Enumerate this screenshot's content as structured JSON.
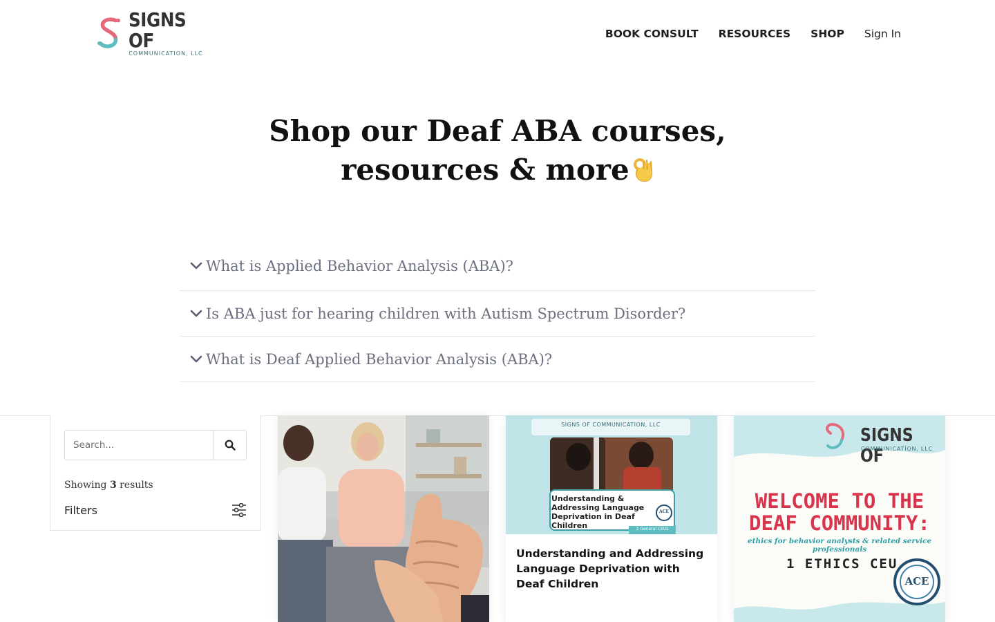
{
  "header": {
    "logo": {
      "title": "SIGNS OF",
      "subtitle": "COMMUNICATION, LLC"
    },
    "nav": [
      {
        "label": "BOOK CONSULT"
      },
      {
        "label": "RESOURCES"
      },
      {
        "label": "SHOP"
      },
      {
        "label": "Sign In"
      }
    ]
  },
  "hero": {
    "line1": "Shop our Deaf ABA courses,",
    "line2": "resources & more"
  },
  "faq": [
    {
      "question": "What is Applied Behavior Analysis (ABA)?"
    },
    {
      "question": "Is ABA just for hearing children with Autism Spectrum Disorder?"
    },
    {
      "question": "What is Deaf Applied Behavior Analysis (ABA)?"
    }
  ],
  "sidebar": {
    "search_placeholder": "Search...",
    "showing_prefix": "Showing",
    "showing_count": "3",
    "showing_suffix": "results",
    "filters_label": "Filters"
  },
  "products": [
    {
      "title": ""
    },
    {
      "title": "Understanding and Addressing Language Deprivation with Deaf Children",
      "image_header": "SIGNS OF COMMUNICATION, LLC",
      "image_caption": "Understanding & Addressing Language Deprivation in Deaf Children",
      "image_tag": "2 General CEUs",
      "image_seal": "ACE"
    },
    {
      "title": "",
      "image_logo_title": "SIGNS OF",
      "image_logo_sub": "COMMUNICATION, LLC",
      "image_heading_1": "WELCOME TO THE",
      "image_heading_2": "DEAF COMMUNITY:",
      "image_subheading": "ethics for behavior analysts & related service professionals",
      "image_ceu": "1 ETHICS CEU",
      "image_seal": "ACE"
    }
  ],
  "colors": {
    "brand_pink": "#e46a7b",
    "brand_teal": "#5fbcc0",
    "faq_text": "#6c7080",
    "welcome_red": "#d8344c"
  }
}
